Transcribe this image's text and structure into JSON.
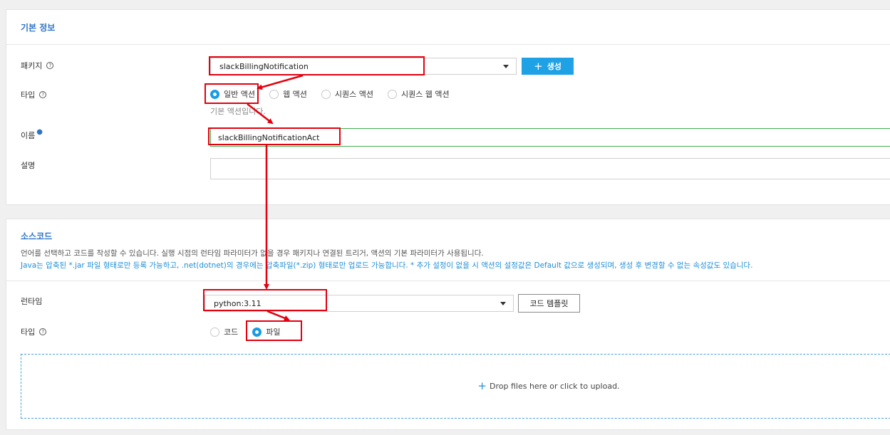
{
  "basic_info": {
    "title": "기본 정보",
    "package": {
      "label": "패키지",
      "value": "slackBillingNotification",
      "create_button": "생성"
    },
    "type": {
      "label": "타입",
      "options": [
        "일반 액션",
        "웹 액션",
        "시퀀스 액션",
        "시퀀스 웹 액션"
      ],
      "selected": "일반 액션",
      "helper": "기본 액션입니다."
    },
    "name": {
      "label": "이름",
      "value": "slackBillingNotificationAct"
    },
    "description": {
      "label": "설명",
      "value": ""
    }
  },
  "source_code": {
    "title": "소스코드",
    "desc_line1": "언어를 선택하고 코드를 작성할 수 있습니다. 실행 시점의 런타임 파라미터가 없을 경우 패키지나 연결된 트리거, 액션의 기본 파라미터가 사용됩니다.",
    "desc_line2": "Java는 압축된 *.jar 파일 형태로만 등록 가능하고, .net(dotnet)의 경우에는 압축파일(*.zip) 형태로만 업로드 가능합니다. * 추가 설정이 없을 시 액션의 설정값은 Default 값으로 생성되며, 생성 후 변경할 수 없는 속성값도 있습니다.",
    "runtime": {
      "label": "런타임",
      "value": "python:3.11",
      "template_button": "코드 템플릿"
    },
    "type": {
      "label": "타입",
      "options": [
        "코드",
        "파일"
      ],
      "selected": "파일"
    },
    "dropzone": {
      "text": "Drop files here or click to upload."
    }
  },
  "colors": {
    "accent": "#1fa1e5",
    "title_blue": "#2f75c6",
    "annotation_red": "#e3000f",
    "valid_green": "#3fb04d"
  }
}
